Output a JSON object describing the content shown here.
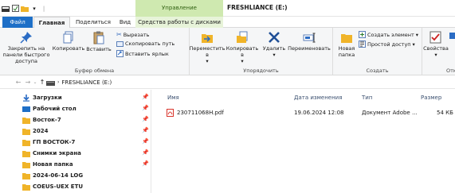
{
  "window": {
    "title": "FRESHLIANCE (E:)",
    "context_group": "Управление"
  },
  "tabs": {
    "file": "Файл",
    "home": "Главная",
    "share": "Поделиться",
    "view": "Вид",
    "disk": "Средства работы с дисками"
  },
  "ribbon": {
    "pin_quick_access": "Закрепить на панели быстрого доступа",
    "copy": "Копировать",
    "paste": "Вставить",
    "cut": "Вырезать",
    "copy_path": "Скопировать путь",
    "paste_shortcut": "Вставить ярлык",
    "clipboard_group": "Буфер обмена",
    "move_to": "Переместить в",
    "copy_to": "Копировать в",
    "delete": "Удалить",
    "rename": "Переименовать",
    "organize_group": "Упорядочить",
    "new_folder": "Новая папка",
    "new_item": "Создать элемент",
    "easy_access": "Простой доступ",
    "create_group": "Создать",
    "properties": "Свойства",
    "open_group": "Откр"
  },
  "address": {
    "path": "FRESHLIANCE (E:)"
  },
  "nav": {
    "items": [
      {
        "label": "Загрузки",
        "icon": "download-icon",
        "pinned": true
      },
      {
        "label": "Рабочий стол",
        "icon": "desktop-icon",
        "pinned": true
      },
      {
        "label": "Восток-7",
        "icon": "folder-icon",
        "pinned": true
      },
      {
        "label": "2024",
        "icon": "folder-icon",
        "pinned": true
      },
      {
        "label": "ГП ВОСТОК-7",
        "icon": "folder-icon",
        "pinned": true
      },
      {
        "label": "Снимки экрана",
        "icon": "folder-icon",
        "pinned": true
      },
      {
        "label": "Новая папка",
        "icon": "folder-icon",
        "pinned": true
      },
      {
        "label": "2024-06-14 LOG",
        "icon": "folder-icon",
        "pinned": false
      },
      {
        "label": "COEUS-UEX ETU",
        "icon": "folder-icon",
        "pinned": false
      }
    ]
  },
  "columns": {
    "name": "Имя",
    "date": "Дата изменения",
    "type": "Тип",
    "size": "Размер"
  },
  "files": [
    {
      "name": "230711068H.pdf",
      "date": "19.06.2024 12:08",
      "type": "Документ Adobe ...",
      "size": "54 КБ"
    }
  ],
  "colors": {
    "file_tab": "#1e6fc7",
    "context_green": "#cfe9b0",
    "folder": "#f0b429",
    "pdf_red": "#d9342b"
  }
}
